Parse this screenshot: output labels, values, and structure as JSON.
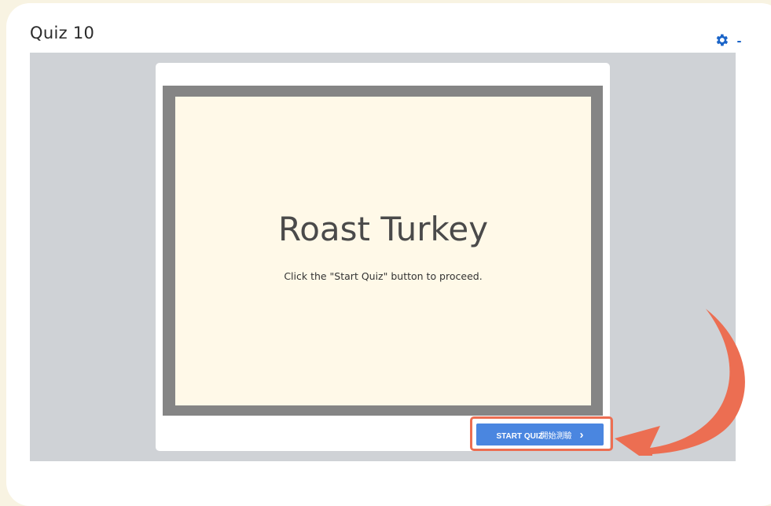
{
  "quiz": {
    "title": "Quiz 10"
  },
  "slide": {
    "title": "Roast Turkey",
    "instruction": "Click the \"Start Quiz\" button to proceed."
  },
  "controls": {
    "start_label": "START QUIZ",
    "start_label_cn": "開始測驗",
    "start_chevron": "›"
  },
  "colors": {
    "page_bg": "#f8f3e2",
    "stage_bg": "#cfd2d6",
    "slide_bg": "#fff9e8",
    "frame": "#858585",
    "accent": "#4a86e0",
    "highlight": "#ec6e52",
    "gear": "#1a64c8"
  },
  "icons": {
    "settings": "gear-icon",
    "dropdown": "caret-down-icon",
    "annotation": "curved-arrow-icon"
  }
}
